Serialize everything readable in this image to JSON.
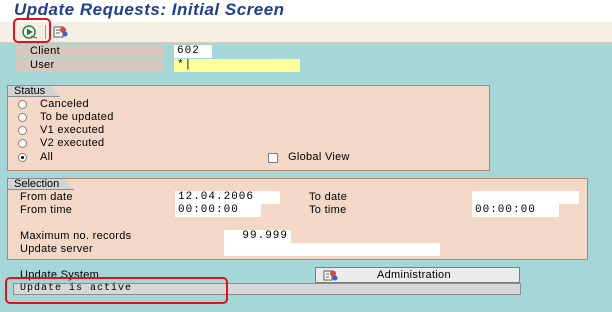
{
  "window": {
    "title": "Update Requests: Initial Screen"
  },
  "toolbar": {
    "execute_icon": "execute-icon",
    "variant_icon": "variant-icon"
  },
  "header_fields": {
    "client_label": "Client",
    "client_value": "602",
    "user_label": "User",
    "user_value": "*|"
  },
  "status_group": {
    "title": "Status",
    "options": [
      {
        "label": "Canceled",
        "selected": false
      },
      {
        "label": "To be updated",
        "selected": false
      },
      {
        "label": "V1 executed",
        "selected": false
      },
      {
        "label": "V2 executed",
        "selected": false
      },
      {
        "label": "All",
        "selected": true
      }
    ],
    "global_view_label": "Global View",
    "global_view_checked": false
  },
  "selection_group": {
    "title": "Selection",
    "from_date_label": "From date",
    "from_date_value": "12.04.2006",
    "to_date_label": "To date",
    "to_date_value": "",
    "from_time_label": "From time",
    "from_time_value": "00:00:00",
    "to_time_label": "To time",
    "to_time_value": "00:00:00",
    "max_records_label": "Maximum no. records",
    "max_records_value": "99.999",
    "update_server_label": "Update server",
    "update_server_value": ""
  },
  "update_system": {
    "label": "Update System",
    "admin_button_label": "Administration",
    "admin_icon": "administration-icon"
  },
  "statusbar": {
    "message": "Update is active"
  },
  "colors": {
    "title": "#1f3f8f",
    "background": "#a5d6d8",
    "group_background": "#f3d8c8",
    "highlight": "#e3101e",
    "required_field": "#ffff99"
  }
}
